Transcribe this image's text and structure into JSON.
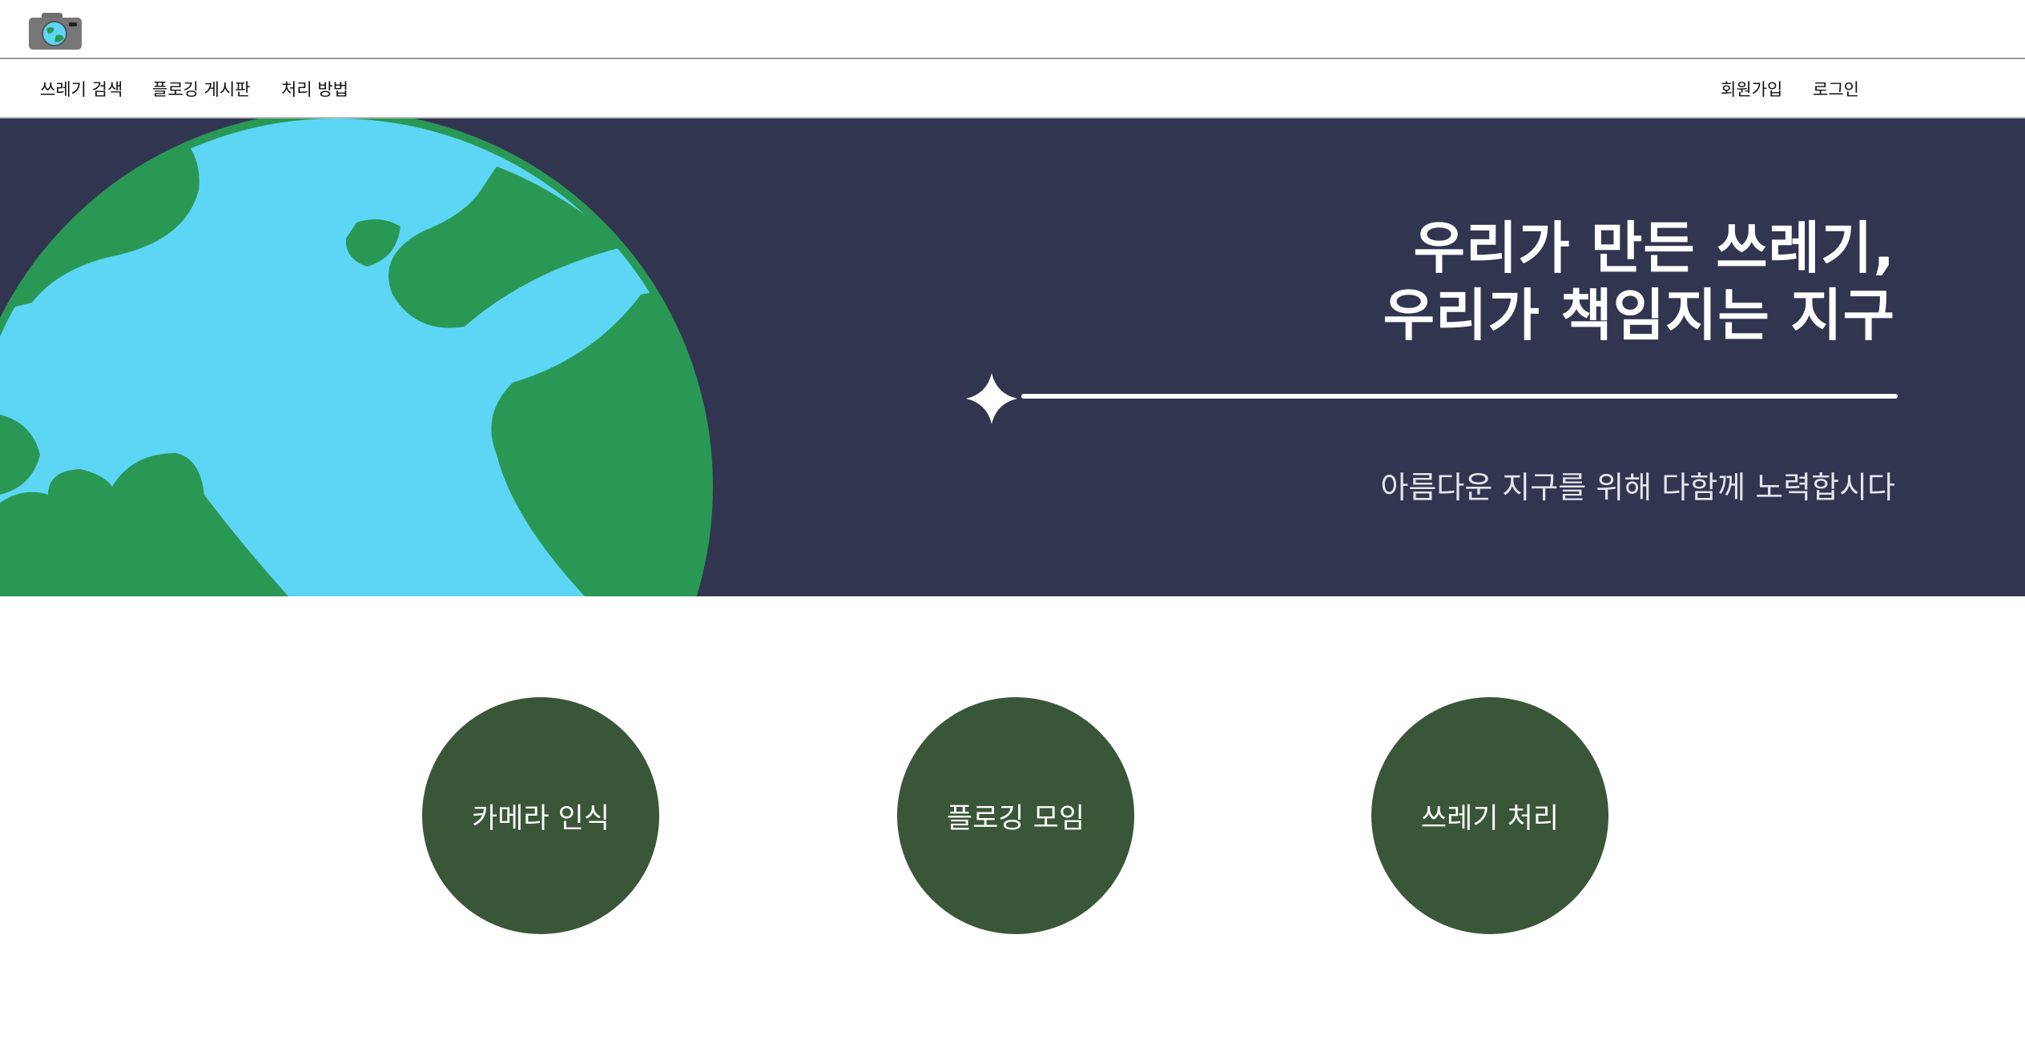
{
  "header": {
    "logo_icon": "camera-earth-icon"
  },
  "nav": {
    "left_items": [
      {
        "label": "쓰레기 검색"
      },
      {
        "label": "플로깅 게시판"
      },
      {
        "label": "처리 방법"
      }
    ],
    "right_items": [
      {
        "label": "회원가입"
      },
      {
        "label": "로그인"
      }
    ]
  },
  "hero": {
    "title_line1": "우리가 만든 쓰레기,",
    "title_line2": "우리가 책임지는 지구",
    "subtitle": "아름다운 지구를 위해 다함께 노력합시다",
    "background_color": "#323550",
    "illustration_icon": "earth-globe-icon",
    "divider_icon": "sparkle-star-icon"
  },
  "features": [
    {
      "label": "카메라 인식"
    },
    {
      "label": "플로깅 모임"
    },
    {
      "label": "쓰레기 처리"
    }
  ],
  "colors": {
    "feature_circle": "#3a5638",
    "ocean": "#5dd6f5",
    "land": "#2a9855"
  }
}
